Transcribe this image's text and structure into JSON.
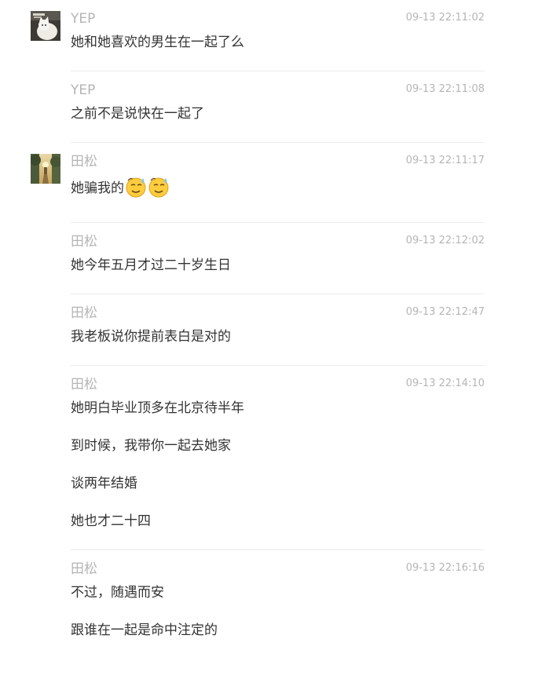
{
  "messages": [
    {
      "sender": "YEP",
      "time": "09-13 22:11:02",
      "avatar": "cat-photo-avatar",
      "lines": [
        "她和她喜欢的男生在一起了么"
      ]
    },
    {
      "sender": "YEP",
      "time": "09-13 22:11:08",
      "lines": [
        "之前不是说快在一起了"
      ]
    },
    {
      "sender": "田松",
      "time": "09-13 22:11:17",
      "avatar": "road-sunset-avatar",
      "lines": [
        "她骗我的"
      ],
      "emojis": [
        "sweat-smile-emoji",
        "sweat-smile-emoji"
      ]
    },
    {
      "sender": "田松",
      "time": "09-13 22:12:02",
      "lines": [
        "她今年五月才过二十岁生日"
      ]
    },
    {
      "sender": "田松",
      "time": "09-13 22:12:47",
      "lines": [
        "我老板说你提前表白是对的"
      ]
    },
    {
      "sender": "田松",
      "time": "09-13 22:14:10",
      "lines": [
        "她明白毕业顶多在北京待半年",
        "到时候，我带你一起去她家",
        "谈两年结婚",
        "她也才二十四"
      ]
    },
    {
      "sender": "田松",
      "time": "09-13 22:16:16",
      "lines": [
        "不过，随遇而安",
        "跟谁在一起是命中注定的"
      ]
    }
  ],
  "colors": {
    "sender": "#b5b5b5",
    "time": "#b5b5b5",
    "text": "#333333",
    "divider": "#ececec"
  }
}
